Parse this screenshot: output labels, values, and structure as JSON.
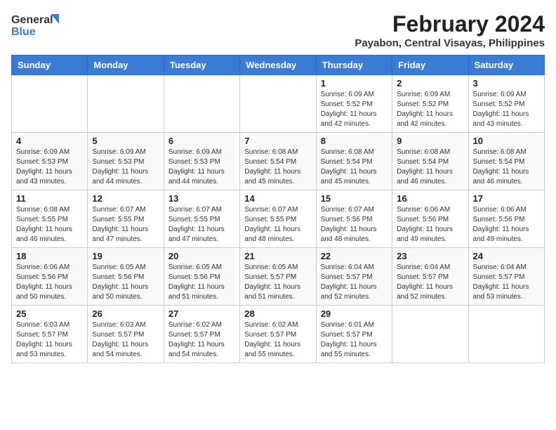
{
  "logo": {
    "general": "General",
    "blue": "Blue"
  },
  "title": "February 2024",
  "subtitle": "Payabon, Central Visayas, Philippines",
  "headers": [
    "Sunday",
    "Monday",
    "Tuesday",
    "Wednesday",
    "Thursday",
    "Friday",
    "Saturday"
  ],
  "weeks": [
    [
      {
        "day": "",
        "info": ""
      },
      {
        "day": "",
        "info": ""
      },
      {
        "day": "",
        "info": ""
      },
      {
        "day": "",
        "info": ""
      },
      {
        "day": "1",
        "info": "Sunrise: 6:09 AM\nSunset: 5:52 PM\nDaylight: 11 hours and 42 minutes."
      },
      {
        "day": "2",
        "info": "Sunrise: 6:09 AM\nSunset: 5:52 PM\nDaylight: 11 hours and 42 minutes."
      },
      {
        "day": "3",
        "info": "Sunrise: 6:09 AM\nSunset: 5:52 PM\nDaylight: 11 hours and 43 minutes."
      }
    ],
    [
      {
        "day": "4",
        "info": "Sunrise: 6:09 AM\nSunset: 5:53 PM\nDaylight: 11 hours and 43 minutes."
      },
      {
        "day": "5",
        "info": "Sunrise: 6:09 AM\nSunset: 5:53 PM\nDaylight: 11 hours and 44 minutes."
      },
      {
        "day": "6",
        "info": "Sunrise: 6:09 AM\nSunset: 5:53 PM\nDaylight: 11 hours and 44 minutes."
      },
      {
        "day": "7",
        "info": "Sunrise: 6:08 AM\nSunset: 5:54 PM\nDaylight: 11 hours and 45 minutes."
      },
      {
        "day": "8",
        "info": "Sunrise: 6:08 AM\nSunset: 5:54 PM\nDaylight: 11 hours and 45 minutes."
      },
      {
        "day": "9",
        "info": "Sunrise: 6:08 AM\nSunset: 5:54 PM\nDaylight: 11 hours and 46 minutes."
      },
      {
        "day": "10",
        "info": "Sunrise: 6:08 AM\nSunset: 5:54 PM\nDaylight: 11 hours and 46 minutes."
      }
    ],
    [
      {
        "day": "11",
        "info": "Sunrise: 6:08 AM\nSunset: 5:55 PM\nDaylight: 11 hours and 46 minutes."
      },
      {
        "day": "12",
        "info": "Sunrise: 6:07 AM\nSunset: 5:55 PM\nDaylight: 11 hours and 47 minutes."
      },
      {
        "day": "13",
        "info": "Sunrise: 6:07 AM\nSunset: 5:55 PM\nDaylight: 11 hours and 47 minutes."
      },
      {
        "day": "14",
        "info": "Sunrise: 6:07 AM\nSunset: 5:55 PM\nDaylight: 11 hours and 48 minutes."
      },
      {
        "day": "15",
        "info": "Sunrise: 6:07 AM\nSunset: 5:56 PM\nDaylight: 11 hours and 48 minutes."
      },
      {
        "day": "16",
        "info": "Sunrise: 6:06 AM\nSunset: 5:56 PM\nDaylight: 11 hours and 49 minutes."
      },
      {
        "day": "17",
        "info": "Sunrise: 6:06 AM\nSunset: 5:56 PM\nDaylight: 11 hours and 49 minutes."
      }
    ],
    [
      {
        "day": "18",
        "info": "Sunrise: 6:06 AM\nSunset: 5:56 PM\nDaylight: 11 hours and 50 minutes."
      },
      {
        "day": "19",
        "info": "Sunrise: 6:05 AM\nSunset: 5:56 PM\nDaylight: 11 hours and 50 minutes."
      },
      {
        "day": "20",
        "info": "Sunrise: 6:05 AM\nSunset: 5:56 PM\nDaylight: 11 hours and 51 minutes."
      },
      {
        "day": "21",
        "info": "Sunrise: 6:05 AM\nSunset: 5:57 PM\nDaylight: 11 hours and 51 minutes."
      },
      {
        "day": "22",
        "info": "Sunrise: 6:04 AM\nSunset: 5:57 PM\nDaylight: 11 hours and 52 minutes."
      },
      {
        "day": "23",
        "info": "Sunrise: 6:04 AM\nSunset: 5:57 PM\nDaylight: 11 hours and 52 minutes."
      },
      {
        "day": "24",
        "info": "Sunrise: 6:04 AM\nSunset: 5:57 PM\nDaylight: 11 hours and 53 minutes."
      }
    ],
    [
      {
        "day": "25",
        "info": "Sunrise: 6:03 AM\nSunset: 5:57 PM\nDaylight: 11 hours and 53 minutes."
      },
      {
        "day": "26",
        "info": "Sunrise: 6:03 AM\nSunset: 5:57 PM\nDaylight: 11 hours and 54 minutes."
      },
      {
        "day": "27",
        "info": "Sunrise: 6:02 AM\nSunset: 5:57 PM\nDaylight: 11 hours and 54 minutes."
      },
      {
        "day": "28",
        "info": "Sunrise: 6:02 AM\nSunset: 5:57 PM\nDaylight: 11 hours and 55 minutes."
      },
      {
        "day": "29",
        "info": "Sunrise: 6:01 AM\nSunset: 5:57 PM\nDaylight: 11 hours and 55 minutes."
      },
      {
        "day": "",
        "info": ""
      },
      {
        "day": "",
        "info": ""
      }
    ]
  ]
}
